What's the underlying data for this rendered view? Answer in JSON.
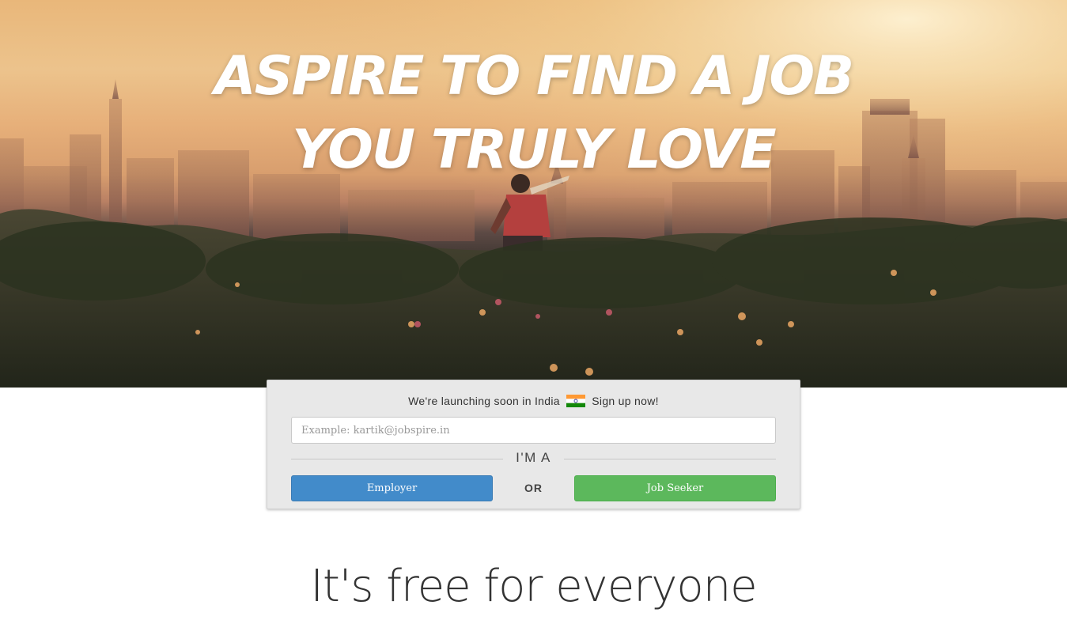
{
  "hero": {
    "headline_line1": "ASPIRE TO FIND A JOB",
    "headline_line2": "YOU TRULY LOVE"
  },
  "signup": {
    "launch_text": "We're launching soon in India",
    "flag_icon": "india-flag-icon",
    "signup_text": "Sign up now!",
    "email_placeholder": "Example: kartik@jobspire.in",
    "email_value": "",
    "role_label": "I'M A",
    "employer_label": "Employer",
    "or_label": "OR",
    "seeker_label": "Job Seeker"
  },
  "section": {
    "title": "It's free for everyone"
  },
  "colors": {
    "employer_button": "#428bca",
    "seeker_button": "#5cb85c",
    "card_background": "#e8e8e8",
    "flag_saffron": "#ff9933",
    "flag_white": "#ffffff",
    "flag_green": "#138808",
    "flag_chakra": "#000080"
  }
}
